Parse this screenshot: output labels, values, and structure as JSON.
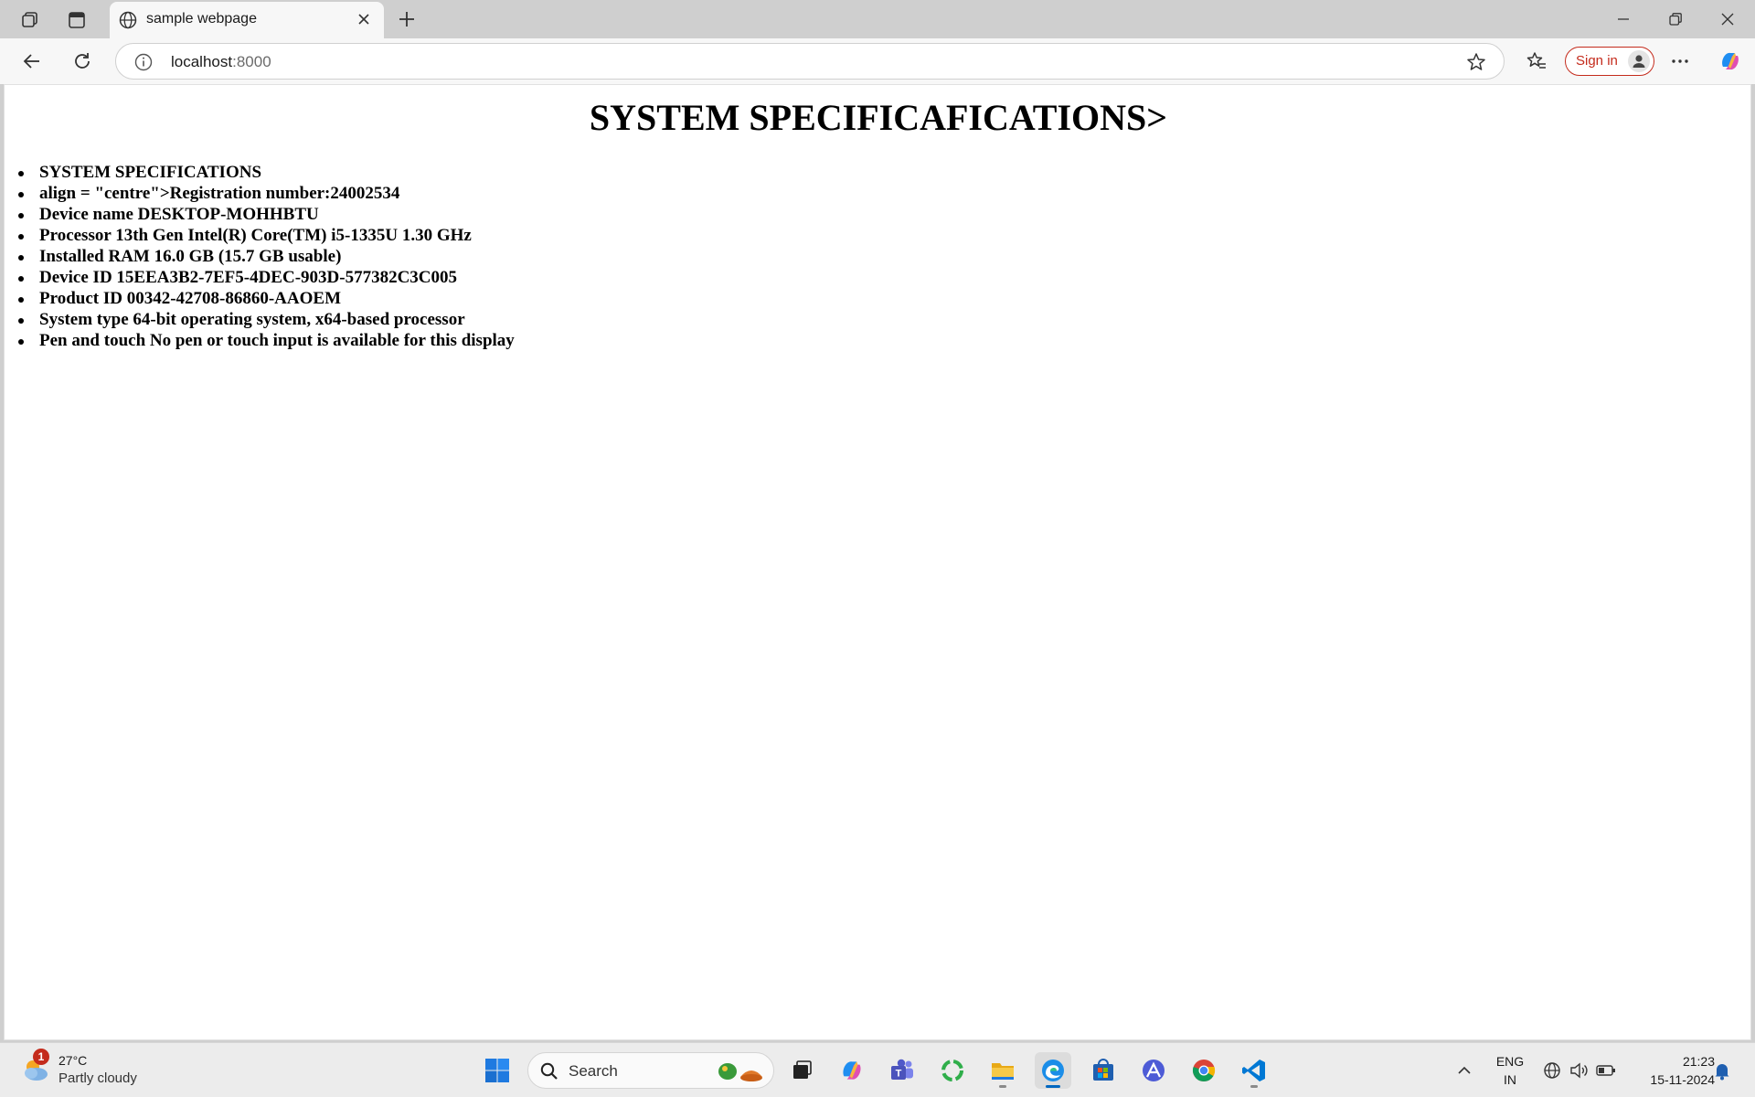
{
  "browser": {
    "tab_title": "sample webpage",
    "url_host": "localhost",
    "url_port": ":8000",
    "signin_label": "Sign in"
  },
  "page": {
    "heading": "SYSTEM SPECIFICAFICATIONS>",
    "items": [
      "SYSTEM SPECIFICATIONS",
      "align = \"centre\">Registration number:24002534",
      "Device name DESKTOP-MOHHBTU",
      "Processor 13th Gen Intel(R) Core(TM) i5-1335U 1.30 GHz",
      "Installed RAM 16.0 GB (15.7 GB usable)",
      "Device ID 15EEA3B2-7EF5-4DEC-903D-577382C3C005",
      "Product ID 00342-42708-86860-AAOEM",
      "System type 64-bit operating system, x64-based processor",
      "Pen and touch No pen or touch input is available for this display"
    ]
  },
  "taskbar": {
    "weather_temp": "27°C",
    "weather_condition": "Partly cloudy",
    "weather_badge": "1",
    "search_label": "Search",
    "language_line1": "ENG",
    "language_line2": "IN",
    "time": "21:23",
    "date": "15-11-2024",
    "apps": [
      "start-icon",
      "task-view-icon",
      "copilot-icon",
      "teams-icon",
      "refresh-app-icon",
      "file-explorer-icon",
      "edge-icon",
      "store-icon",
      "affinity-icon",
      "chrome-icon",
      "vscode-icon"
    ]
  },
  "colors": {
    "accent_red": "#c42b1c",
    "accent_blue": "#0067c0",
    "chrome_bg": "#cfcfcf",
    "tab_bg": "#f7f7f7"
  }
}
